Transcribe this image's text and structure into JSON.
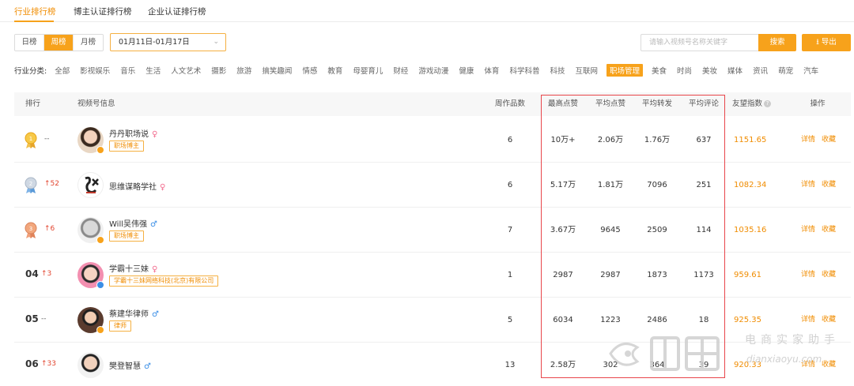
{
  "top_tabs": [
    {
      "label": "行业排行榜",
      "active": true
    },
    {
      "label": "博主认证排行榜",
      "active": false
    },
    {
      "label": "企业认证排行榜",
      "active": false
    }
  ],
  "period_buttons": [
    {
      "label": "日榜",
      "active": false
    },
    {
      "label": "周榜",
      "active": true
    },
    {
      "label": "月榜",
      "active": false
    }
  ],
  "date_range": "01月11日-01月17日",
  "search": {
    "placeholder": "请输入视频号名称关键字",
    "button": "搜索"
  },
  "export_label": "导出",
  "category": {
    "label": "行业分类:",
    "items": [
      "全部",
      "影视娱乐",
      "音乐",
      "生活",
      "人文艺术",
      "摄影",
      "旅游",
      "搞笑趣闻",
      "情感",
      "教育",
      "母婴育儿",
      "财经",
      "游戏动漫",
      "健康",
      "体育",
      "科学科普",
      "科技",
      "互联网",
      "职场管理",
      "美食",
      "时尚",
      "美妆",
      "媒体",
      "资讯",
      "萌宠",
      "汽车"
    ],
    "active": "职场管理"
  },
  "table": {
    "headers": {
      "rank": "排行",
      "info": "视频号信息",
      "weekly": "周作品数",
      "max_likes": "最高点赞",
      "avg_likes": "平均点赞",
      "avg_shares": "平均转发",
      "avg_comments": "平均评论",
      "score": "友望指数",
      "action": "操作"
    },
    "rows": [
      {
        "rank": "",
        "medal": "gold",
        "trend": "--",
        "trend_dir": "flat",
        "name": "丹丹职场说",
        "gender": "♀",
        "gender_type": "f",
        "tag": "职场博主",
        "weekly": "6",
        "max_likes": "10万+",
        "avg_likes": "2.06万",
        "avg_shares": "1.76万",
        "avg_comments": "637",
        "score": "1151.65",
        "detail": "详情",
        "fav": "收藏"
      },
      {
        "rank": "",
        "medal": "silver",
        "trend": "52",
        "trend_dir": "up",
        "name": "思维谋略学社",
        "gender": "♀",
        "gender_type": "f",
        "tag": "",
        "weekly": "6",
        "max_likes": "5.17万",
        "avg_likes": "1.81万",
        "avg_shares": "7096",
        "avg_comments": "251",
        "score": "1082.34",
        "detail": "详情",
        "fav": "收藏"
      },
      {
        "rank": "",
        "medal": "bronze",
        "trend": "6",
        "trend_dir": "up",
        "name": "Will吴伟强",
        "gender": "♂",
        "gender_type": "m",
        "tag": "职场博主",
        "weekly": "7",
        "max_likes": "3.67万",
        "avg_likes": "9645",
        "avg_shares": "2509",
        "avg_comments": "114",
        "score": "1035.16",
        "detail": "详情",
        "fav": "收藏"
      },
      {
        "rank": "04",
        "medal": "",
        "trend": "3",
        "trend_dir": "up",
        "name": "学霸十三妹",
        "gender": "♀",
        "gender_type": "f",
        "tag": "学霸十三妹网络科技(北京)有限公司",
        "weekly": "1",
        "max_likes": "2987",
        "avg_likes": "2987",
        "avg_shares": "1873",
        "avg_comments": "1173",
        "score": "959.61",
        "detail": "详情",
        "fav": "收藏"
      },
      {
        "rank": "05",
        "medal": "",
        "trend": "--",
        "trend_dir": "flat",
        "name": "蔡建华律师",
        "gender": "♂",
        "gender_type": "m",
        "tag": "律师",
        "weekly": "5",
        "max_likes": "6034",
        "avg_likes": "1223",
        "avg_shares": "2486",
        "avg_comments": "18",
        "score": "925.35",
        "detail": "详情",
        "fav": "收藏"
      },
      {
        "rank": "06",
        "medal": "",
        "trend": "33",
        "trend_dir": "up",
        "name": "樊登智慧",
        "gender": "♂",
        "gender_type": "m",
        "tag": "",
        "weekly": "13",
        "max_likes": "2.58万",
        "avg_likes": "302",
        "avg_shares": "364",
        "avg_comments": "39",
        "score": "920.33",
        "detail": "详情",
        "fav": "收藏"
      }
    ]
  },
  "watermark": {
    "cn": "电商实家助手",
    "en": "dianxiaoyu.com"
  },
  "colors": {
    "accent": "#f7a21b",
    "up": "#e2452f",
    "highlight": "#e8464b"
  }
}
